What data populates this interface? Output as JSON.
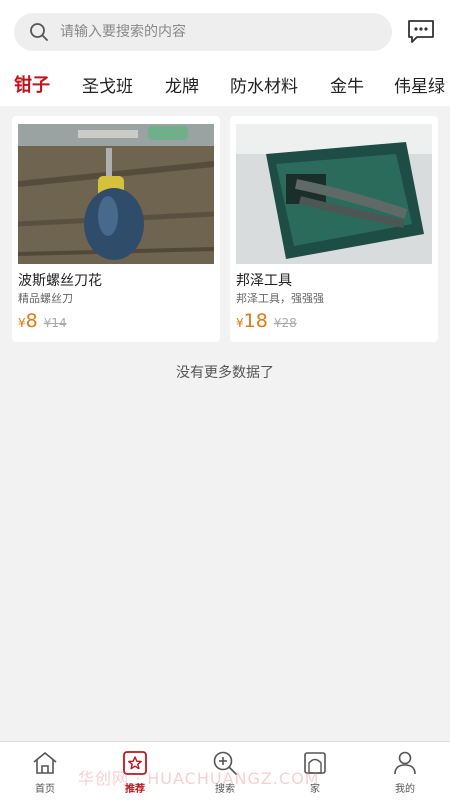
{
  "search": {
    "placeholder": "请输入要搜索的内容",
    "icon": "search-icon"
  },
  "header": {
    "message_icon": "message-icon"
  },
  "categories": [
    "钳子",
    "圣戈班",
    "龙牌",
    "防水材料",
    "金牛",
    "伟星绿"
  ],
  "active_category_index": 0,
  "products": [
    {
      "title": "波斯螺丝刀花",
      "subtitle": "精品螺丝刀",
      "currency": "¥",
      "price": "8",
      "original_price": "¥14"
    },
    {
      "title": "邦泽工具",
      "subtitle": "邦泽工具，强强强",
      "currency": "¥",
      "price": "18",
      "original_price": "¥28"
    }
  ],
  "no_more_text": "没有更多数据了",
  "bottom_nav": [
    {
      "label": "首页",
      "icon": "home-icon"
    },
    {
      "label": "推荐",
      "icon": "recommend-star-icon"
    },
    {
      "label": "搜索",
      "icon": "search-plus-icon"
    },
    {
      "label": "家",
      "icon": "house-icon"
    },
    {
      "label": "我的",
      "icon": "profile-icon"
    }
  ],
  "active_nav_index": 1,
  "watermark": "华创网 · HUACHUANGZ.COM",
  "colors": {
    "accent": "#c0141c",
    "price": "#e07a18",
    "background": "#f2f2f2"
  }
}
